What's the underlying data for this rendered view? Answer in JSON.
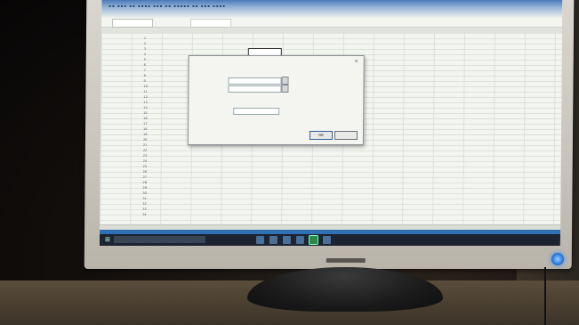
{
  "screen": {
    "app": "spreadsheet",
    "taskbar_search_placeholder": "",
    "dialog_ok_label": "OK",
    "dialog_cancel_label": "",
    "row_numbers": [
      "1",
      "2",
      "3",
      "4",
      "5",
      "6",
      "7",
      "8",
      "9",
      "10",
      "11",
      "12",
      "13",
      "14",
      "15",
      "16",
      "17",
      "18",
      "19",
      "20",
      "21",
      "22",
      "23",
      "24",
      "25",
      "26",
      "27",
      "28",
      "29",
      "30",
      "31",
      "32",
      "33",
      "34"
    ]
  },
  "colors": {
    "monitor_bezel": "#c8c4bb",
    "screen_bg": "#e9ece6",
    "taskbar": "#1b2430",
    "power_led": "#2f7fe0"
  },
  "icons": [
    "windows-start-icon",
    "excel-icon",
    "power-led-icon"
  ]
}
